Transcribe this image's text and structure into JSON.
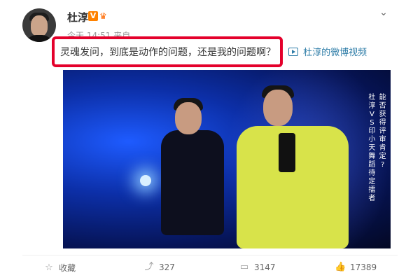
{
  "post": {
    "username": "杜淳",
    "caption": "灵魂发问，到底是动作的问题，还是我的问题啊？",
    "video_link": "杜淳的微博视频",
    "more_icon": "chevron-down-icon",
    "time": "今天 14:51 来自"
  },
  "video": {
    "subtitle_columns": [
      [
        "能",
        "否",
        "获",
        "得",
        "评",
        "审",
        "肯",
        "定",
        "?"
      ],
      [
        "杜",
        "淳",
        "V",
        "S",
        "印",
        "小",
        "天",
        "舞",
        "蹈",
        "待",
        "定",
        "擂",
        "者"
      ]
    ]
  },
  "actions": {
    "favorite": {
      "icon": "star-icon",
      "label": "收藏"
    },
    "repost": {
      "icon": "repost-icon",
      "count": "327"
    },
    "comment": {
      "icon": "comment-icon",
      "count": "3147"
    },
    "like": {
      "icon": "thumbs-up-icon",
      "count": "17389"
    }
  },
  "colors": {
    "highlight_border": "#e4002b",
    "link": "#2d7ca7",
    "vip_badge": "#ff8200"
  }
}
